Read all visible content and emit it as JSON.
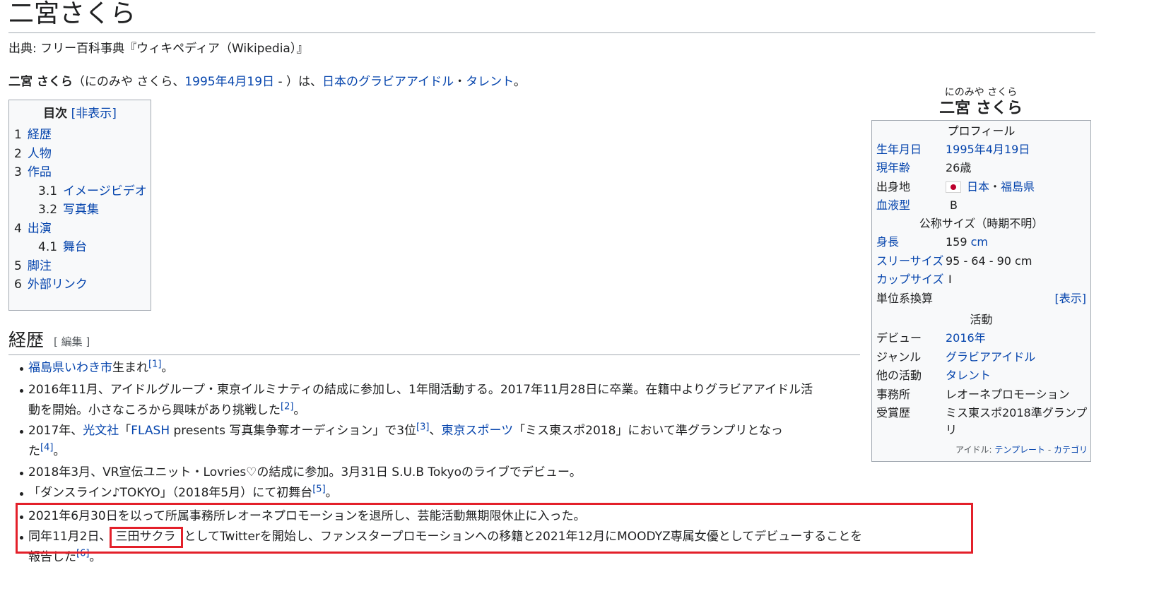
{
  "page": {
    "title": "二宮さくら",
    "source": "出典: フリー百科事典『ウィキペディア（Wikipedia）』"
  },
  "lead": {
    "name": "二宮 さくら",
    "reading": "（にのみや さくら、",
    "birthdate_link": "1995年4月19日",
    "middle": " - ）は、",
    "link_japan": "日本",
    "link_no": "の",
    "link_gravure": "グラビアアイドル",
    "dot": "・",
    "link_talent": "タレント",
    "end": "。"
  },
  "toc": {
    "title": "目次",
    "toggle": "[非表示]",
    "items": [
      {
        "num": "1",
        "label": "経歴"
      },
      {
        "num": "2",
        "label": "人物"
      },
      {
        "num": "3",
        "label": "作品"
      },
      {
        "num": "3.1",
        "label": "イメージビデオ"
      },
      {
        "num": "3.2",
        "label": "写真集"
      },
      {
        "num": "4",
        "label": "出演"
      },
      {
        "num": "4.1",
        "label": "舞台"
      },
      {
        "num": "5",
        "label": "脚注"
      },
      {
        "num": "6",
        "label": "外部リンク"
      }
    ]
  },
  "section": {
    "heading": "経歴",
    "edit": "[ 編集 ]"
  },
  "bullets": {
    "b1": {
      "link": "福島県いわき市",
      "text": "生まれ",
      "ref": "[1]",
      "end": "。"
    },
    "b2": {
      "line1": "2016年11月、アイドルグループ・東京イルミナティの結成に参加し、1年間活動する。2017年11月28日に卒業。在籍中よりグラビアアイドル活",
      "line2": "動を開始。小さなころから興味があり挑戦した",
      "ref": "[2]",
      "end": "。"
    },
    "b3": {
      "t1": "2017年、",
      "link1": "光文社",
      "t2": "「",
      "link2": "FLASH",
      "t3": " presents 写真集争奪オーディション」で3位",
      "ref1": "[3]",
      "t4": "、",
      "link3": "東京スポーツ",
      "t5": "「ミス東スポ2018」において準グランプリとなっ",
      "line2": "た",
      "ref2": "[4]",
      "end": "。"
    },
    "b4": {
      "text": "2018年3月、VR宣伝ユニット・Lovries♡の結成に参加。3月31日 S.U.B Tokyoのライブでデビュー。"
    },
    "b5": {
      "text": "「ダンスライン♪TOKYO」（2018年5月）にて初舞台",
      "ref": "[5]",
      "end": "。"
    },
    "b6": {
      "text": "2021年6月30日を以って所属事務所レオーネプロモーションを退所し、芸能活動無期限休止に入った。"
    },
    "b7": {
      "t1": "同年11月2日、",
      "name": "三田サクラ",
      "t2": "としてTwitterを開始し、ファンスタープロモーションへの移籍と2021年12月にMOODYZ専属女優としてデビューすることを報告した",
      "ref": "[6]",
      "end": "。"
    }
  },
  "infobox": {
    "ruby": "にのみや さくら",
    "name": "二宮 さくら",
    "profile_header": "プロフィール",
    "birth_label": "生年月日",
    "birth_value": "1995年4月19日",
    "age_label": "現年齢",
    "age_value": "26歳",
    "origin_label": "出身地",
    "origin_country": "日本",
    "origin_dot": "・",
    "origin_pref": "福島県",
    "blood_label": "血液型",
    "blood_value": "B",
    "size_header": "公称サイズ（時期不明）",
    "height_label": "身長",
    "height_num": "159 ",
    "height_unit": "cm",
    "three_label": "スリーサイズ",
    "three_value": "95 - 64 - 90 cm",
    "cup_label": "カップサイズ",
    "cup_value": "I",
    "unit_label": "単位系換算",
    "unit_toggle": "[表示]",
    "activity_header": "活動",
    "debut_label": "デビュー",
    "debut_value": "2016年",
    "genre_label": "ジャンル",
    "genre_value": "グラビアアイドル",
    "other_label": "他の活動",
    "other_value": "タレント",
    "agency_label": "事務所",
    "agency_value": "レオーネプロモーション",
    "award_label": "受賞歴",
    "award_line1": "ミス東スポ2018準グランプ",
    "award_line2": "リ",
    "footer_prefix": "アイドル: ",
    "footer_template": "テンプレート",
    "footer_sep": " - ",
    "footer_category": "カテゴリ"
  }
}
